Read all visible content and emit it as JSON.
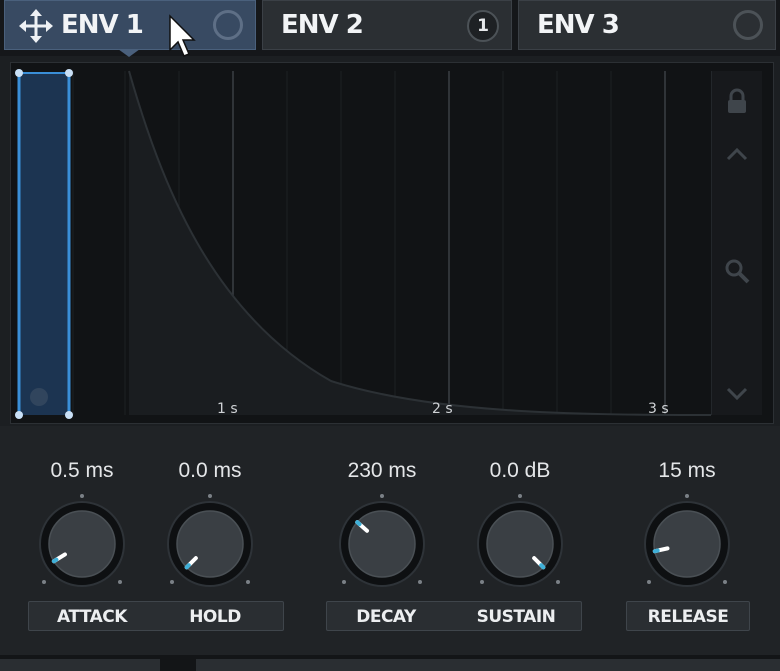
{
  "tabs": [
    {
      "label": "ENV 1",
      "active": true
    },
    {
      "label": "ENV 2",
      "badge": "1"
    },
    {
      "label": "ENV 3"
    }
  ],
  "graph": {
    "time_labels": [
      "1 s",
      "2 s",
      "3 s"
    ]
  },
  "knobs": [
    {
      "value": "0.5 ms",
      "label": "ATTACK",
      "level": 0.05
    },
    {
      "value": "0.0 ms",
      "label": "HOLD",
      "level": 0.0
    },
    {
      "value": "230 ms",
      "label": "DECAY",
      "level": 0.32
    },
    {
      "value": "0.0 dB",
      "label": "SUSTAIN",
      "level": 1.0
    },
    {
      "value": "15 ms",
      "label": "RELEASE",
      "level": 0.12
    }
  ],
  "colors": {
    "accent": "#3a8fd8",
    "knob_indicator": "#3fb0d8"
  }
}
